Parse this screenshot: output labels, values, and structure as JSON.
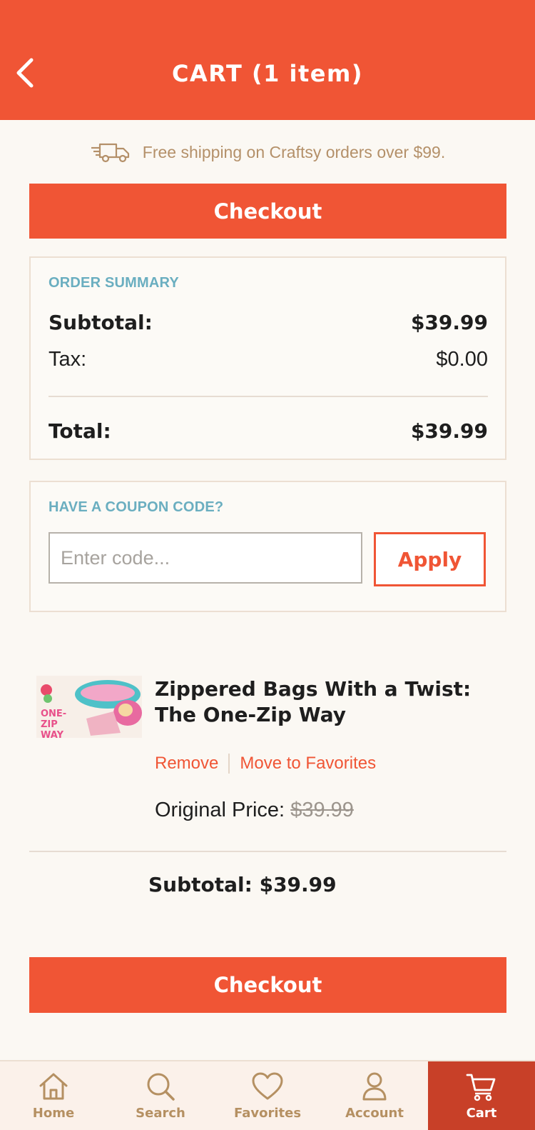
{
  "header": {
    "title": "CART (1 item)"
  },
  "shipping_banner": {
    "text": "Free shipping on Craftsy orders over $99."
  },
  "checkout_label": "Checkout",
  "order_summary": {
    "heading": "ORDER SUMMARY",
    "subtotal_label": "Subtotal:",
    "subtotal_value": "$39.99",
    "tax_label": "Tax:",
    "tax_value": "$0.00",
    "total_label": "Total:",
    "total_value": "$39.99"
  },
  "coupon": {
    "heading": "HAVE A COUPON CODE?",
    "placeholder": "Enter code...",
    "value": "",
    "apply_label": "Apply"
  },
  "item": {
    "title": "Zippered Bags With a Twist: The One-Zip Way",
    "thumb_text": "ONE-ZIP WAY",
    "remove_label": "Remove",
    "favorites_label": "Move to Favorites",
    "original_price_label": "Original Price:",
    "original_price": "$39.99",
    "subtotal_text": "Subtotal: $39.99"
  },
  "tabs": [
    {
      "label": "Home",
      "icon": "home-icon"
    },
    {
      "label": "Search",
      "icon": "search-icon"
    },
    {
      "label": "Favorites",
      "icon": "heart-icon"
    },
    {
      "label": "Account",
      "icon": "user-icon"
    },
    {
      "label": "Cart",
      "icon": "cart-icon",
      "active": true
    }
  ],
  "colors": {
    "brand": "#f05535",
    "label_blue": "#6aaec0",
    "muted_tan": "#b59062",
    "active_tab": "#c84028"
  }
}
